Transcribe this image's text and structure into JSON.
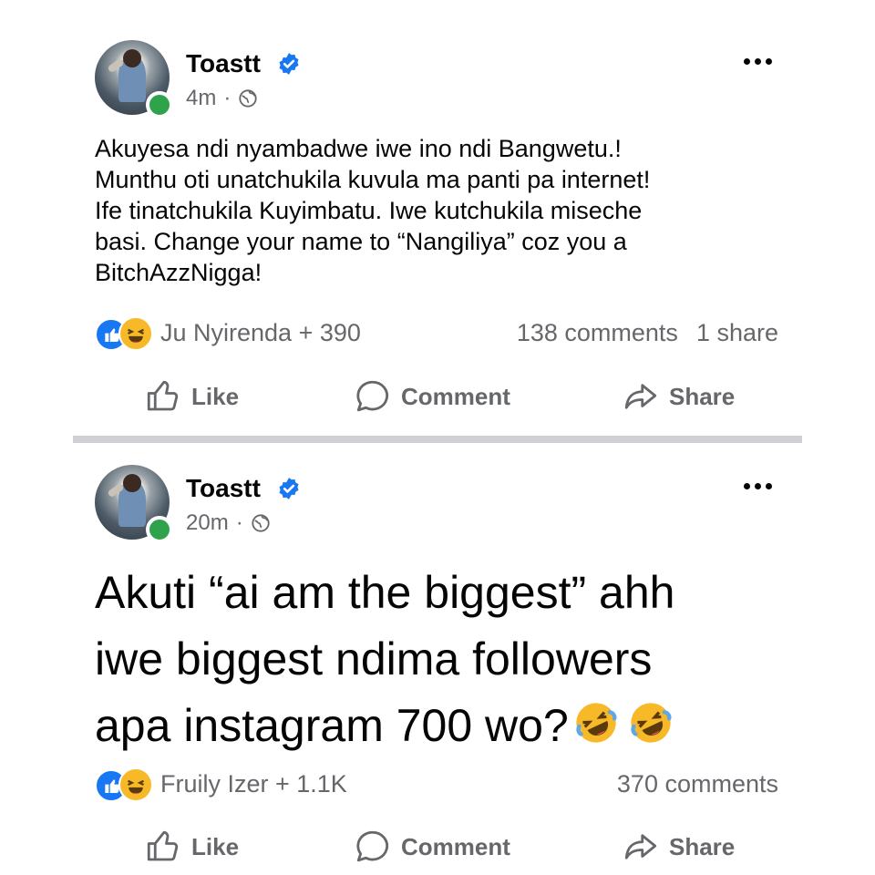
{
  "colors": {
    "verified": "#1877f2",
    "online": "#31a24c",
    "muted": "#65676b",
    "like": "#1877f2",
    "haha": "#f7b928"
  },
  "posts": [
    {
      "author": "Toastt",
      "time": "4m",
      "separator": "·",
      "text_lines": [
        "Akuyesa ndi nyambadwe iwe ino ndi Bangwetu.!",
        "Munthu oti unatchukila kuvula ma panti pa internet!",
        "Ife tinatchukila Kuyimbatu. Iwe kutchukila miseche",
        "basi. Change your name to “Nangiliya” coz you a",
        "BitchAzzNigga!"
      ],
      "reactions": {
        "icons": [
          "like-icon",
          "haha-icon"
        ],
        "label": "Ju Nyirenda + 390"
      },
      "comments": "138 comments",
      "shares": "1 share",
      "actions": {
        "like": "Like",
        "comment": "Comment",
        "share": "Share"
      }
    },
    {
      "author": "Toastt",
      "time": "20m",
      "separator": "·",
      "text_lines": [
        "Akuti “ai am the biggest” ahh",
        "iwe biggest ndima followers",
        "apa instagram 700 wo?"
      ],
      "emoji": [
        "rofl-emoji",
        "rofl-emoji"
      ],
      "reactions": {
        "icons": [
          "like-icon",
          "haha-icon"
        ],
        "label": "Fruily Izer + 1.1K"
      },
      "comments": "370 comments",
      "actions": {
        "like": "Like",
        "comment": "Comment",
        "share": "Share"
      }
    }
  ]
}
